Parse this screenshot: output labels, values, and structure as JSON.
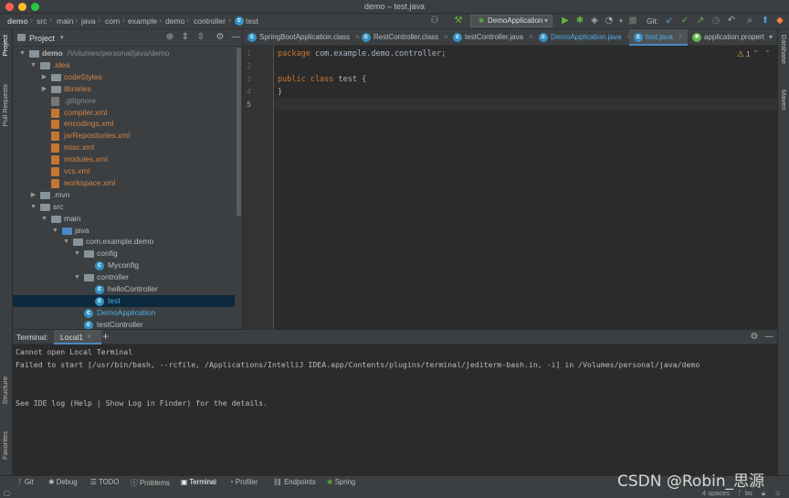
{
  "window": {
    "title": "demo – test.java",
    "traffic_lights": [
      "#ff5f57",
      "#febc2e",
      "#28c840"
    ]
  },
  "breadcrumbs": [
    "demo",
    "src",
    "main",
    "java",
    "com",
    "example",
    "demo",
    "controller",
    "test"
  ],
  "toolbar": {
    "run_config": "DemoApplication",
    "git_label": "Git:",
    "icons": [
      "user-icon",
      "hammer-icon",
      "run-icon",
      "debug-icon",
      "coverage-icon",
      "profile-icon",
      "stop-icon",
      "git-update-icon",
      "git-commit-icon",
      "git-push-icon",
      "history-icon",
      "rollback-icon",
      "search-icon",
      "update-icon",
      "jetbrains-icon"
    ]
  },
  "project_panel": {
    "title": "Project",
    "tree": [
      {
        "label": "demo",
        "path": "/Volumes/personal/java/demo",
        "depth": 0,
        "expanded": true,
        "type": "module"
      },
      {
        "label": ".idea",
        "depth": 1,
        "expanded": true,
        "type": "folder",
        "color": "orange"
      },
      {
        "label": "codeStyles",
        "depth": 2,
        "expanded": false,
        "type": "folder",
        "color": "orange"
      },
      {
        "label": "libraries",
        "depth": 2,
        "expanded": false,
        "type": "folder",
        "color": "orange"
      },
      {
        "label": ".gitignore",
        "depth": 2,
        "type": "gitignore",
        "color": "grey"
      },
      {
        "label": "compiler.xml",
        "depth": 2,
        "type": "xml",
        "color": "orange"
      },
      {
        "label": "encodings.xml",
        "depth": 2,
        "type": "xml",
        "color": "orange"
      },
      {
        "label": "jarRepositories.xml",
        "depth": 2,
        "type": "xml",
        "color": "orange"
      },
      {
        "label": "misc.xml",
        "depth": 2,
        "type": "xml",
        "color": "orange"
      },
      {
        "label": "modules.xml",
        "depth": 2,
        "type": "xml",
        "color": "orange"
      },
      {
        "label": "vcs.xml",
        "depth": 2,
        "type": "xml",
        "color": "orange"
      },
      {
        "label": "workspace.xml",
        "depth": 2,
        "type": "xml",
        "color": "orange"
      },
      {
        "label": ".mvn",
        "depth": 1,
        "expanded": false,
        "type": "folder",
        "color": "default"
      },
      {
        "label": "src",
        "depth": 1,
        "expanded": true,
        "type": "folder",
        "color": "default"
      },
      {
        "label": "main",
        "depth": 2,
        "expanded": true,
        "type": "folder",
        "color": "default"
      },
      {
        "label": "java",
        "depth": 3,
        "expanded": true,
        "type": "srcfolder",
        "color": "default"
      },
      {
        "label": "com.example.demo",
        "depth": 4,
        "expanded": true,
        "type": "package",
        "color": "default"
      },
      {
        "label": "config",
        "depth": 5,
        "expanded": true,
        "type": "package",
        "color": "default"
      },
      {
        "label": "Myconfig",
        "depth": 6,
        "type": "class",
        "color": "default"
      },
      {
        "label": "controller",
        "depth": 5,
        "expanded": true,
        "type": "package",
        "color": "default"
      },
      {
        "label": "helloController",
        "depth": 6,
        "type": "class",
        "color": "default"
      },
      {
        "label": "test",
        "depth": 6,
        "type": "class",
        "color": "teal",
        "selected": true
      },
      {
        "label": "DemoApplication",
        "depth": 5,
        "type": "springclass",
        "color": "teal"
      },
      {
        "label": "testController",
        "depth": 5,
        "type": "class",
        "color": "default"
      }
    ]
  },
  "editor_tabs": [
    {
      "label": "SpringBootApplication.class",
      "active": false
    },
    {
      "label": "RestController.class",
      "active": false
    },
    {
      "label": "testController.java",
      "active": false
    },
    {
      "label": "DemoApplication.java",
      "active": false
    },
    {
      "label": "test.java",
      "active": true
    },
    {
      "label": "application.propert",
      "active": false
    }
  ],
  "editor": {
    "warning_count": "1",
    "lines": [
      {
        "num": "1",
        "kw": "package",
        "rest": " com.example.demo.controller;"
      },
      {
        "num": "2",
        "kw": "",
        "rest": ""
      },
      {
        "num": "3",
        "kw": "public class",
        "rest": " test {"
      },
      {
        "num": "4",
        "kw": "",
        "rest": "}"
      },
      {
        "num": "5",
        "kw": "",
        "rest": ""
      }
    ]
  },
  "terminal": {
    "title": "Terminal:",
    "tab": "Local1",
    "add": "+",
    "lines": [
      "Cannot open Local Terminal",
      "Failed to start [/usr/bin/bash, --rcfile, /Applications/IntelliJ IDEA.app/Contents/plugins/terminal/jediterm-bash.in, -i] in /Volumes/personal/java/demo",
      "",
      "",
      "See IDE log (Help | Show Log in Finder) for the details."
    ]
  },
  "left_stripe": [
    "Project",
    "Pull Requests",
    "Structure",
    "Favorites"
  ],
  "right_stripe": [
    "Database",
    "Maven"
  ],
  "bottom_tools": [
    {
      "label": "Git",
      "active": false
    },
    {
      "label": "Debug",
      "active": false
    },
    {
      "label": "TODO",
      "active": false
    },
    {
      "label": "Problems",
      "active": false
    },
    {
      "label": "Terminal",
      "active": true
    },
    {
      "label": "Profiler",
      "active": false
    },
    {
      "label": "Endpoints",
      "active": false
    },
    {
      "label": "Spring",
      "active": false
    }
  ],
  "status": {
    "indent": "4 spaces",
    "vcs": "bs"
  },
  "watermark": "CSDN @Robin_思源"
}
